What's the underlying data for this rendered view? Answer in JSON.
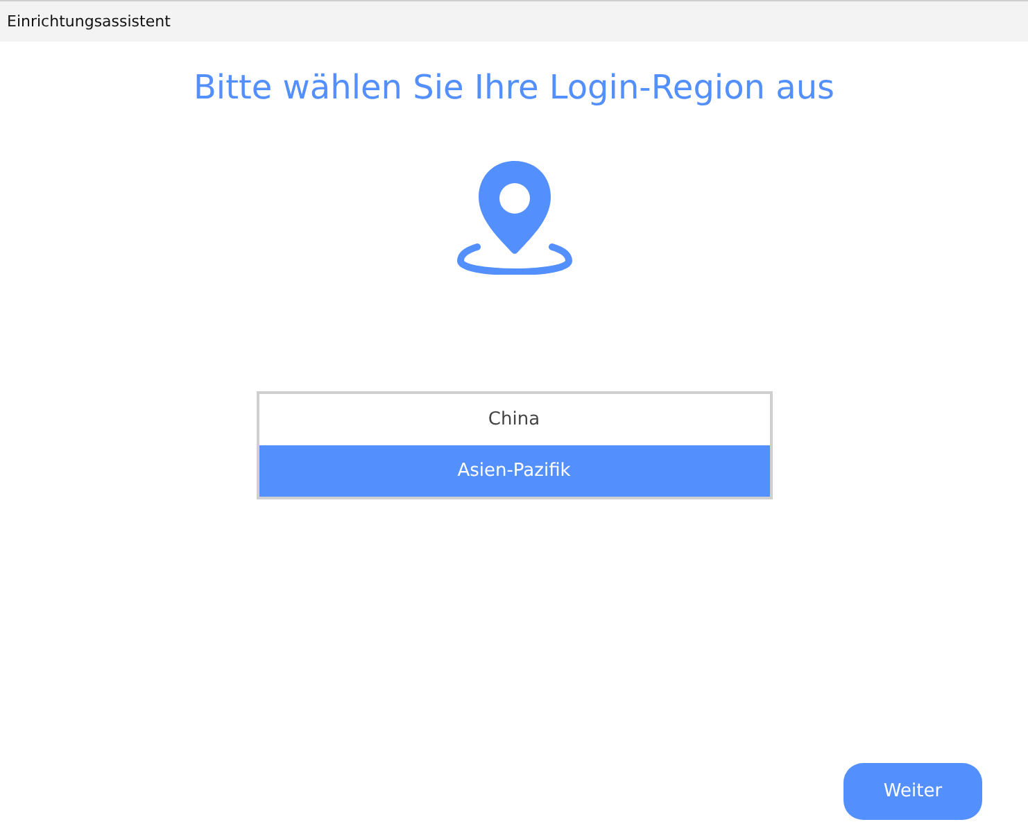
{
  "window": {
    "title": "Einrichtungsassistent"
  },
  "heading": "Bitte wählen Sie Ihre Login-Region aus",
  "regions": [
    {
      "label": "China",
      "selected": false
    },
    {
      "label": "Asien-Pazifik",
      "selected": true
    }
  ],
  "buttons": [
    "Weiter"
  ]
}
